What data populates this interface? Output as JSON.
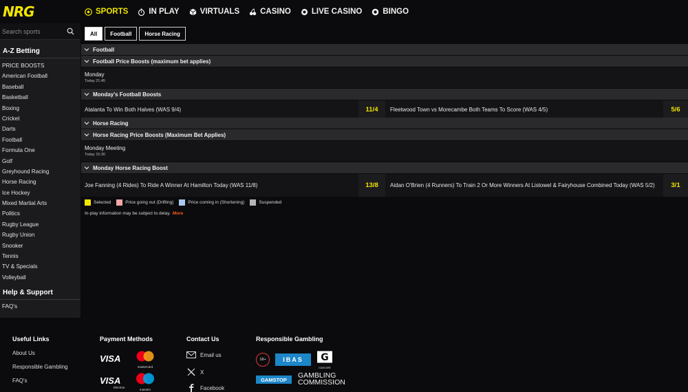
{
  "brand": {
    "logo_text": "NRG",
    "accent": "#f2e600"
  },
  "nav": [
    {
      "label": "SPORTS",
      "icon": "soccer-ball-icon",
      "active": true
    },
    {
      "label": "IN PLAY",
      "icon": "stopwatch-icon"
    },
    {
      "label": "VIRTUALS",
      "icon": "cube-icon"
    },
    {
      "label": "CASINO",
      "icon": "cherries-icon"
    },
    {
      "label": "LIVE CASINO",
      "icon": "live-casino-icon"
    },
    {
      "label": "BINGO",
      "icon": "bingo-ball-icon"
    }
  ],
  "sidebar": {
    "search_placeholder": "Search sports",
    "az_heading": "A-Z Betting",
    "items": [
      "PRICE BOOSTS",
      "American Football",
      "Baseball",
      "Basketball",
      "Boxing",
      "Cricket",
      "Darts",
      "Football",
      "Formula One",
      "Golf",
      "Greyhound Racing",
      "Horse Racing",
      "Ice Hockey",
      "Mixed Martial Arts",
      "Politics",
      "Rugby League",
      "Rugby Union",
      "Snooker",
      "Tennis",
      "TV & Specials",
      "Volleyball"
    ],
    "help_heading": "Help & Support",
    "help_items": [
      "FAQ's"
    ]
  },
  "filters": [
    {
      "label": "All",
      "active": true
    },
    {
      "label": "Football"
    },
    {
      "label": "Horse Racing"
    }
  ],
  "sections": {
    "football": "Football",
    "football_boosts": "Football Price Boosts (maximum bet applies)",
    "monday_meeting_1": {
      "title": "Monday",
      "time": "Today 21:45"
    },
    "mondays_football_boosts": "Monday's Football Boosts",
    "football_selections": [
      {
        "name": "Atalanta To Win Both Halves (WAS 9/4)",
        "price": "11/4"
      },
      {
        "name": "Fleetwood Town vs Morecambe Both Teams To Score (WAS 4/5)",
        "price": "5/6"
      }
    ],
    "horse_racing": "Horse Racing",
    "horse_boosts": "Horse Racing Price Boosts (Maximum Bet Applies)",
    "monday_meeting_2": {
      "title": "Monday Meeting",
      "time": "Today 15:30"
    },
    "monday_horse_boost": "Monday Horse Racing Boost",
    "horse_selections": [
      {
        "name": "Joe Fanning (4 Rides) To Ride A Winner At Hamilton Today (WAS 11/8)",
        "price": "13/8"
      },
      {
        "name": "Aidan O'Brien (4 Runners) To Train 2 Or More Winners At Listowel & Fairyhouse Combined Today (WAS 5/2)",
        "price": "3/1"
      }
    ]
  },
  "legend": [
    {
      "label": "Selected",
      "color": "#f2e600"
    },
    {
      "label": "Price going out (Drifting)",
      "color": "#f4a6a6"
    },
    {
      "label": "Price coming in (Shortening)",
      "color": "#a8c8f0"
    },
    {
      "label": "Suspended",
      "color": "#b5b5b5"
    }
  ],
  "note": {
    "text": "In-play information may be subject to delay.",
    "more": "More"
  },
  "footer": {
    "useful_links_heading": "Useful Links",
    "useful_links": [
      "About Us",
      "Responsible Gambling",
      "FAQ's"
    ],
    "payment_heading": "Payment Methods",
    "payments": {
      "visa": "VISA",
      "mastercard": "mastercard",
      "visa_electron": "VISA",
      "electron": "Electron",
      "maestro": "maestro"
    },
    "contact_heading": "Contact Us",
    "contacts": [
      "Email us",
      "X",
      "Facebook"
    ],
    "rg_heading": "Responsible Gambling",
    "rg": {
      "age": "18+",
      "ibas": "IBAS",
      "gamcare": "GAMCARE",
      "gamstop": "GAMSTOP",
      "commission_1": "GAMBLING",
      "commission_2": "COMMISSION"
    }
  }
}
